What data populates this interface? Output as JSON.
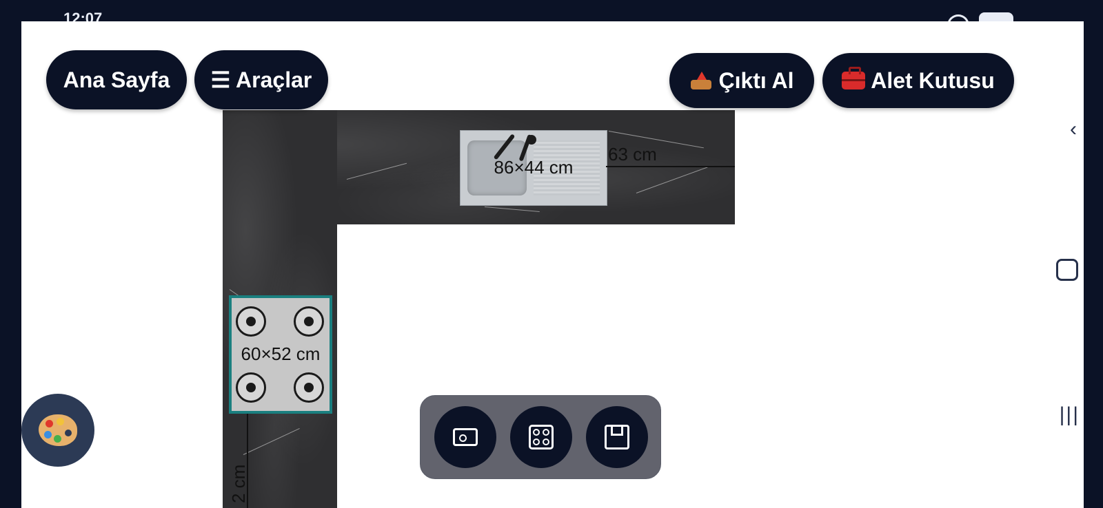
{
  "status_bar": {
    "time": "12:07"
  },
  "header": {
    "home_label": "Ana Sayfa",
    "tools_label": "☰ Araçlar",
    "export_label": "Çıktı Al",
    "toolbox_label": "Alet Kutusu"
  },
  "plan": {
    "sink_label": "86×44 cm",
    "top_dimension": "63 cm",
    "hob_label": "60×52 cm",
    "left_dimension": "2 cm"
  },
  "colors": {
    "dark_navy": "#0b1226",
    "counter": "#2f2f31",
    "hob_border": "#1a7f7f"
  },
  "icons": {
    "palette": "palette-icon",
    "sink_tool": "sink-icon",
    "hob_tool": "hob-icon",
    "panel_tool": "panel-icon"
  }
}
